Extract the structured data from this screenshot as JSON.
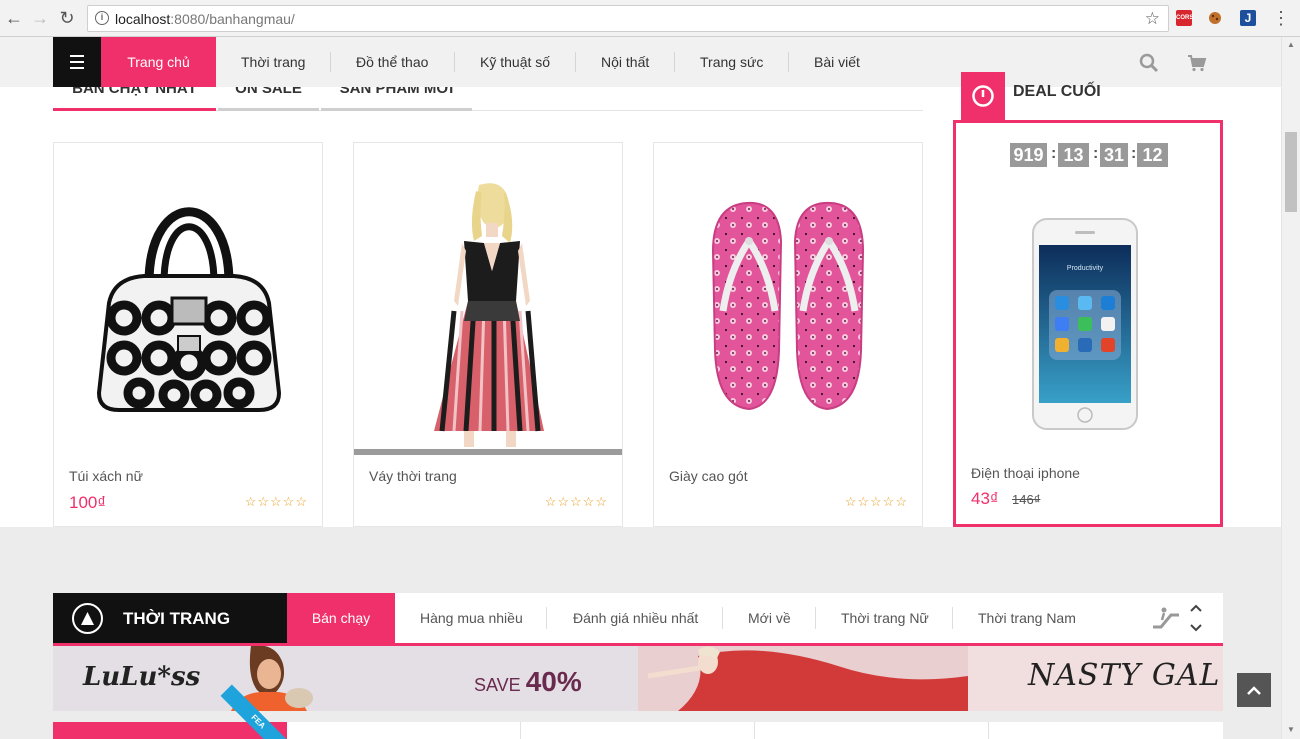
{
  "browser": {
    "url_host": "localhost",
    "url_rest": ":8080/banhangmau/",
    "extensions": [
      "CORS",
      "cookie",
      "J"
    ],
    "menu_glyph": "⋮"
  },
  "nav": {
    "active": "Trang chủ",
    "items": [
      "Thời trang",
      "Đồ thể thao",
      "Kỹ thuật số",
      "Nội thất",
      "Trang sức",
      "Bài viết"
    ]
  },
  "tabs": [
    {
      "label": "Bán chạy nhất",
      "active": true
    },
    {
      "label": "On sale",
      "active": false
    },
    {
      "label": "Sản phẩm mới",
      "active": false
    }
  ],
  "products": [
    {
      "name": "Túi xách nữ",
      "price": "100₫",
      "stars": "☆☆☆☆☆"
    },
    {
      "name": "Váy thời trang",
      "price": "",
      "stars": "☆☆☆☆☆"
    },
    {
      "name": "Giày cao gót",
      "price": "",
      "stars": "☆☆☆☆☆"
    }
  ],
  "deal": {
    "title": "DEAL CUỐI",
    "countdown": [
      "919",
      "13",
      "31",
      "12"
    ],
    "product_name": "Điện thoại iphone",
    "price": "43₫",
    "old_price": "146₫",
    "screen_label": "Productivity"
  },
  "category": {
    "title": "THỜI TRANG",
    "active_tab": "Bán chạy",
    "tabs": [
      "Hàng mua nhiều",
      "Đánh giá nhiều nhất",
      "Mới về",
      "Thời trang Nữ",
      "Thời trang Nam"
    ]
  },
  "banners": {
    "left_brand": "LuLu*ss",
    "left_save": "SAVE",
    "left_percent": "40%",
    "right_brand": "NASTY GAL"
  },
  "ribbon": "FEA",
  "colors": {
    "accent": "#f0306a",
    "dark": "#111111",
    "star": "#e9a126"
  }
}
